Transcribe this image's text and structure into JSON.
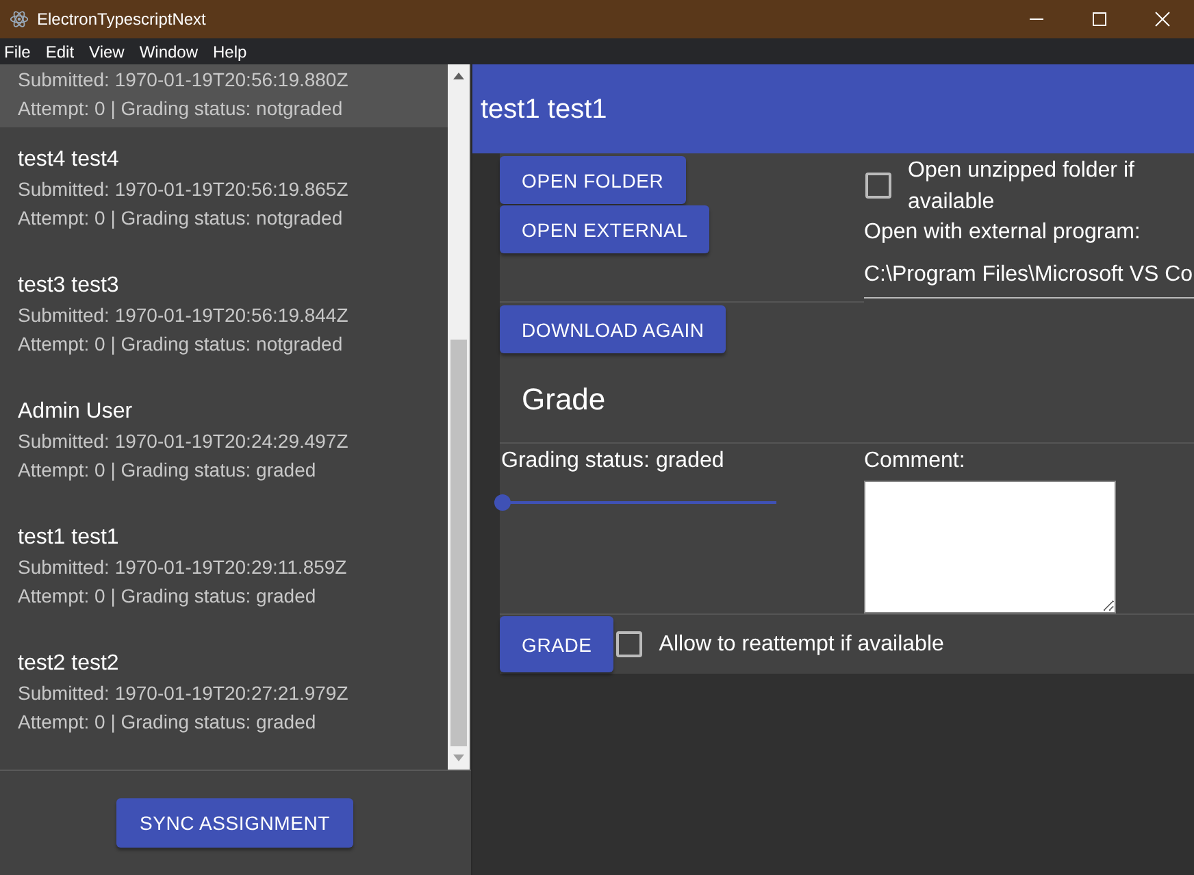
{
  "window": {
    "title": "ElectronTypescriptNext"
  },
  "menu": [
    "File",
    "Edit",
    "View",
    "Window",
    "Help"
  ],
  "submissions": [
    {
      "submitted": "Submitted: 1970-01-19T20:56:19.880Z",
      "details": "Attempt: 0 | Grading status: notgraded",
      "selected": true
    },
    {
      "name": "test4 test4",
      "submitted": "Submitted: 1970-01-19T20:56:19.865Z",
      "details": "Attempt: 0 | Grading status: notgraded",
      "selected": false
    },
    {
      "name": "test3 test3",
      "submitted": "Submitted: 1970-01-19T20:56:19.844Z",
      "details": "Attempt: 0 | Grading status: notgraded",
      "selected": false
    },
    {
      "name": "Admin User",
      "submitted": "Submitted: 1970-01-19T20:24:29.497Z",
      "details": "Attempt: 0 | Grading status: graded",
      "selected": false
    },
    {
      "name": "test1 test1",
      "submitted": "Submitted: 1970-01-19T20:29:11.859Z",
      "details": "Attempt: 0 | Grading status: graded",
      "selected": false
    },
    {
      "name": "test2 test2",
      "submitted": "Submitted: 1970-01-19T20:27:21.979Z",
      "details": "Attempt: 0 | Grading status: graded",
      "selected": false
    }
  ],
  "sync_button": "SYNC ASSIGNMENT",
  "header": {
    "title": "test1 test1"
  },
  "files": {
    "buttons": [
      "OPEN FOLDER",
      "OPEN EXTERNAL"
    ],
    "unzipped": {
      "label": "Open unzipped folder if available",
      "checked": false
    },
    "external_label": "Open with external program:",
    "external_value": "C:\\Program Files\\Microsoft VS Co"
  },
  "download_button": "DOWNLOAD AGAIN",
  "grade": {
    "heading": "Grade",
    "status": "Grading status: graded",
    "level": 0,
    "comment_label": "Comment:",
    "button": "GRADE",
    "reattempt": {
      "label": "Allow to reattempt if available",
      "checked": false
    }
  }
}
